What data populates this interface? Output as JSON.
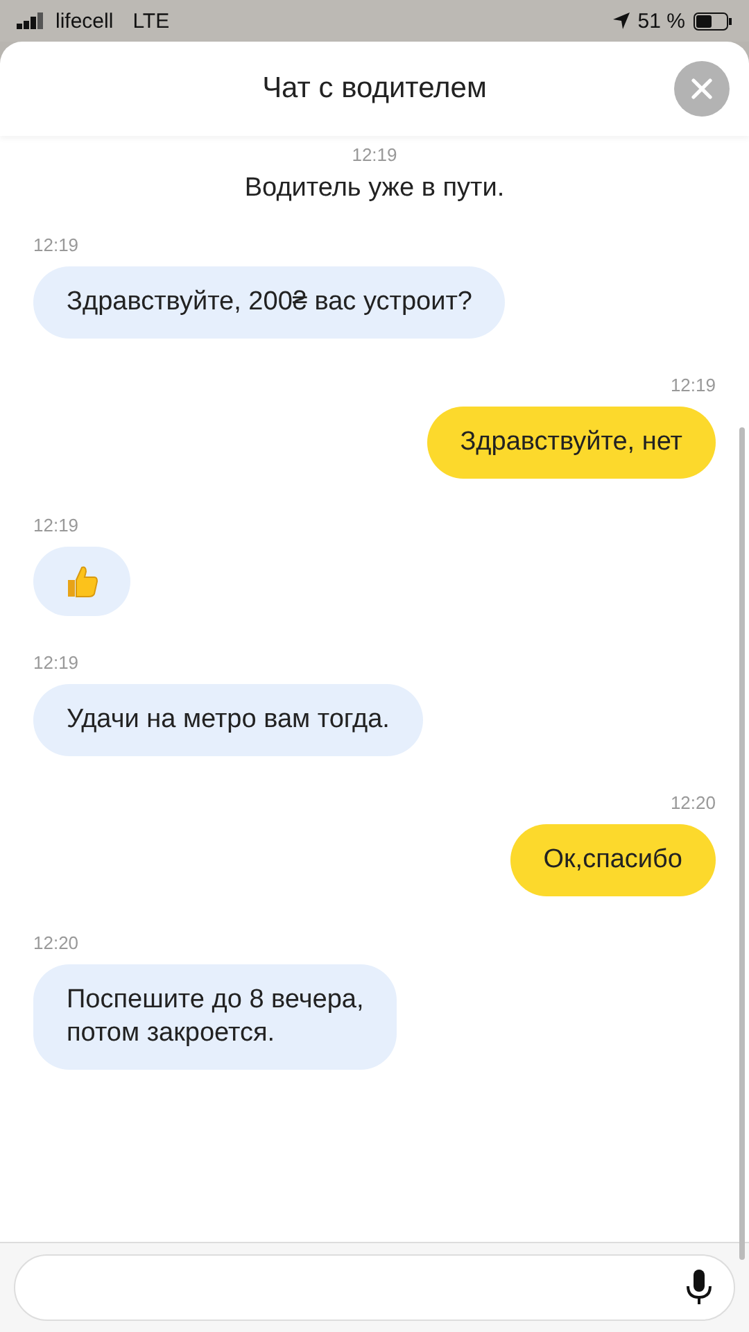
{
  "status_bar": {
    "carrier": "lifecell",
    "network": "LTE",
    "battery": "51 %"
  },
  "header": {
    "title": "Чат с водителем"
  },
  "system_message": {
    "time": "12:19",
    "text": "Водитель уже в пути."
  },
  "messages": [
    {
      "outgoing": false,
      "kind": "text",
      "time": "12:19",
      "text": "Здравствуйте, 200₴ вас устроит?"
    },
    {
      "outgoing": true,
      "kind": "text",
      "time": "12:19",
      "text": "Здравствуйте, нет"
    },
    {
      "outgoing": false,
      "kind": "thumbs_up",
      "time": "12:19"
    },
    {
      "outgoing": false,
      "kind": "text",
      "time": "12:19",
      "text": "Удачи на метро вам тогда."
    },
    {
      "outgoing": true,
      "kind": "text",
      "time": "12:20",
      "text": "Ок,спасибо"
    },
    {
      "outgoing": false,
      "kind": "text",
      "time": "12:20",
      "text": "Поспешите до 8 вечера,\nпотом закроется."
    }
  ]
}
